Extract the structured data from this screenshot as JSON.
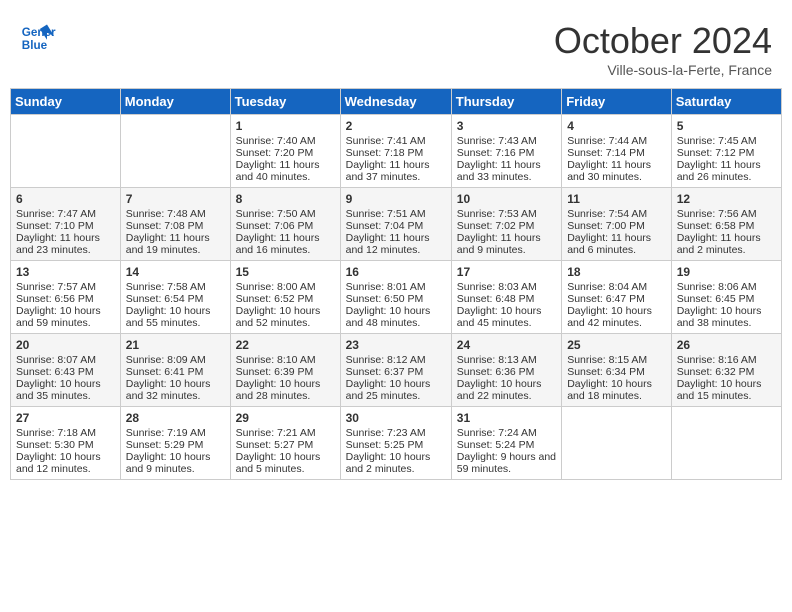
{
  "header": {
    "logo_line1": "General",
    "logo_line2": "Blue",
    "month": "October 2024",
    "location": "Ville-sous-la-Ferte, France"
  },
  "weekdays": [
    "Sunday",
    "Monday",
    "Tuesday",
    "Wednesday",
    "Thursday",
    "Friday",
    "Saturday"
  ],
  "weeks": [
    [
      {
        "day": "",
        "sunrise": "",
        "sunset": "",
        "daylight": ""
      },
      {
        "day": "",
        "sunrise": "",
        "sunset": "",
        "daylight": ""
      },
      {
        "day": "1",
        "sunrise": "Sunrise: 7:40 AM",
        "sunset": "Sunset: 7:20 PM",
        "daylight": "Daylight: 11 hours and 40 minutes."
      },
      {
        "day": "2",
        "sunrise": "Sunrise: 7:41 AM",
        "sunset": "Sunset: 7:18 PM",
        "daylight": "Daylight: 11 hours and 37 minutes."
      },
      {
        "day": "3",
        "sunrise": "Sunrise: 7:43 AM",
        "sunset": "Sunset: 7:16 PM",
        "daylight": "Daylight: 11 hours and 33 minutes."
      },
      {
        "day": "4",
        "sunrise": "Sunrise: 7:44 AM",
        "sunset": "Sunset: 7:14 PM",
        "daylight": "Daylight: 11 hours and 30 minutes."
      },
      {
        "day": "5",
        "sunrise": "Sunrise: 7:45 AM",
        "sunset": "Sunset: 7:12 PM",
        "daylight": "Daylight: 11 hours and 26 minutes."
      }
    ],
    [
      {
        "day": "6",
        "sunrise": "Sunrise: 7:47 AM",
        "sunset": "Sunset: 7:10 PM",
        "daylight": "Daylight: 11 hours and 23 minutes."
      },
      {
        "day": "7",
        "sunrise": "Sunrise: 7:48 AM",
        "sunset": "Sunset: 7:08 PM",
        "daylight": "Daylight: 11 hours and 19 minutes."
      },
      {
        "day": "8",
        "sunrise": "Sunrise: 7:50 AM",
        "sunset": "Sunset: 7:06 PM",
        "daylight": "Daylight: 11 hours and 16 minutes."
      },
      {
        "day": "9",
        "sunrise": "Sunrise: 7:51 AM",
        "sunset": "Sunset: 7:04 PM",
        "daylight": "Daylight: 11 hours and 12 minutes."
      },
      {
        "day": "10",
        "sunrise": "Sunrise: 7:53 AM",
        "sunset": "Sunset: 7:02 PM",
        "daylight": "Daylight: 11 hours and 9 minutes."
      },
      {
        "day": "11",
        "sunrise": "Sunrise: 7:54 AM",
        "sunset": "Sunset: 7:00 PM",
        "daylight": "Daylight: 11 hours and 6 minutes."
      },
      {
        "day": "12",
        "sunrise": "Sunrise: 7:56 AM",
        "sunset": "Sunset: 6:58 PM",
        "daylight": "Daylight: 11 hours and 2 minutes."
      }
    ],
    [
      {
        "day": "13",
        "sunrise": "Sunrise: 7:57 AM",
        "sunset": "Sunset: 6:56 PM",
        "daylight": "Daylight: 10 hours and 59 minutes."
      },
      {
        "day": "14",
        "sunrise": "Sunrise: 7:58 AM",
        "sunset": "Sunset: 6:54 PM",
        "daylight": "Daylight: 10 hours and 55 minutes."
      },
      {
        "day": "15",
        "sunrise": "Sunrise: 8:00 AM",
        "sunset": "Sunset: 6:52 PM",
        "daylight": "Daylight: 10 hours and 52 minutes."
      },
      {
        "day": "16",
        "sunrise": "Sunrise: 8:01 AM",
        "sunset": "Sunset: 6:50 PM",
        "daylight": "Daylight: 10 hours and 48 minutes."
      },
      {
        "day": "17",
        "sunrise": "Sunrise: 8:03 AM",
        "sunset": "Sunset: 6:48 PM",
        "daylight": "Daylight: 10 hours and 45 minutes."
      },
      {
        "day": "18",
        "sunrise": "Sunrise: 8:04 AM",
        "sunset": "Sunset: 6:47 PM",
        "daylight": "Daylight: 10 hours and 42 minutes."
      },
      {
        "day": "19",
        "sunrise": "Sunrise: 8:06 AM",
        "sunset": "Sunset: 6:45 PM",
        "daylight": "Daylight: 10 hours and 38 minutes."
      }
    ],
    [
      {
        "day": "20",
        "sunrise": "Sunrise: 8:07 AM",
        "sunset": "Sunset: 6:43 PM",
        "daylight": "Daylight: 10 hours and 35 minutes."
      },
      {
        "day": "21",
        "sunrise": "Sunrise: 8:09 AM",
        "sunset": "Sunset: 6:41 PM",
        "daylight": "Daylight: 10 hours and 32 minutes."
      },
      {
        "day": "22",
        "sunrise": "Sunrise: 8:10 AM",
        "sunset": "Sunset: 6:39 PM",
        "daylight": "Daylight: 10 hours and 28 minutes."
      },
      {
        "day": "23",
        "sunrise": "Sunrise: 8:12 AM",
        "sunset": "Sunset: 6:37 PM",
        "daylight": "Daylight: 10 hours and 25 minutes."
      },
      {
        "day": "24",
        "sunrise": "Sunrise: 8:13 AM",
        "sunset": "Sunset: 6:36 PM",
        "daylight": "Daylight: 10 hours and 22 minutes."
      },
      {
        "day": "25",
        "sunrise": "Sunrise: 8:15 AM",
        "sunset": "Sunset: 6:34 PM",
        "daylight": "Daylight: 10 hours and 18 minutes."
      },
      {
        "day": "26",
        "sunrise": "Sunrise: 8:16 AM",
        "sunset": "Sunset: 6:32 PM",
        "daylight": "Daylight: 10 hours and 15 minutes."
      }
    ],
    [
      {
        "day": "27",
        "sunrise": "Sunrise: 7:18 AM",
        "sunset": "Sunset: 5:30 PM",
        "daylight": "Daylight: 10 hours and 12 minutes."
      },
      {
        "day": "28",
        "sunrise": "Sunrise: 7:19 AM",
        "sunset": "Sunset: 5:29 PM",
        "daylight": "Daylight: 10 hours and 9 minutes."
      },
      {
        "day": "29",
        "sunrise": "Sunrise: 7:21 AM",
        "sunset": "Sunset: 5:27 PM",
        "daylight": "Daylight: 10 hours and 5 minutes."
      },
      {
        "day": "30",
        "sunrise": "Sunrise: 7:23 AM",
        "sunset": "Sunset: 5:25 PM",
        "daylight": "Daylight: 10 hours and 2 minutes."
      },
      {
        "day": "31",
        "sunrise": "Sunrise: 7:24 AM",
        "sunset": "Sunset: 5:24 PM",
        "daylight": "Daylight: 9 hours and 59 minutes."
      },
      {
        "day": "",
        "sunrise": "",
        "sunset": "",
        "daylight": ""
      },
      {
        "day": "",
        "sunrise": "",
        "sunset": "",
        "daylight": ""
      }
    ]
  ]
}
